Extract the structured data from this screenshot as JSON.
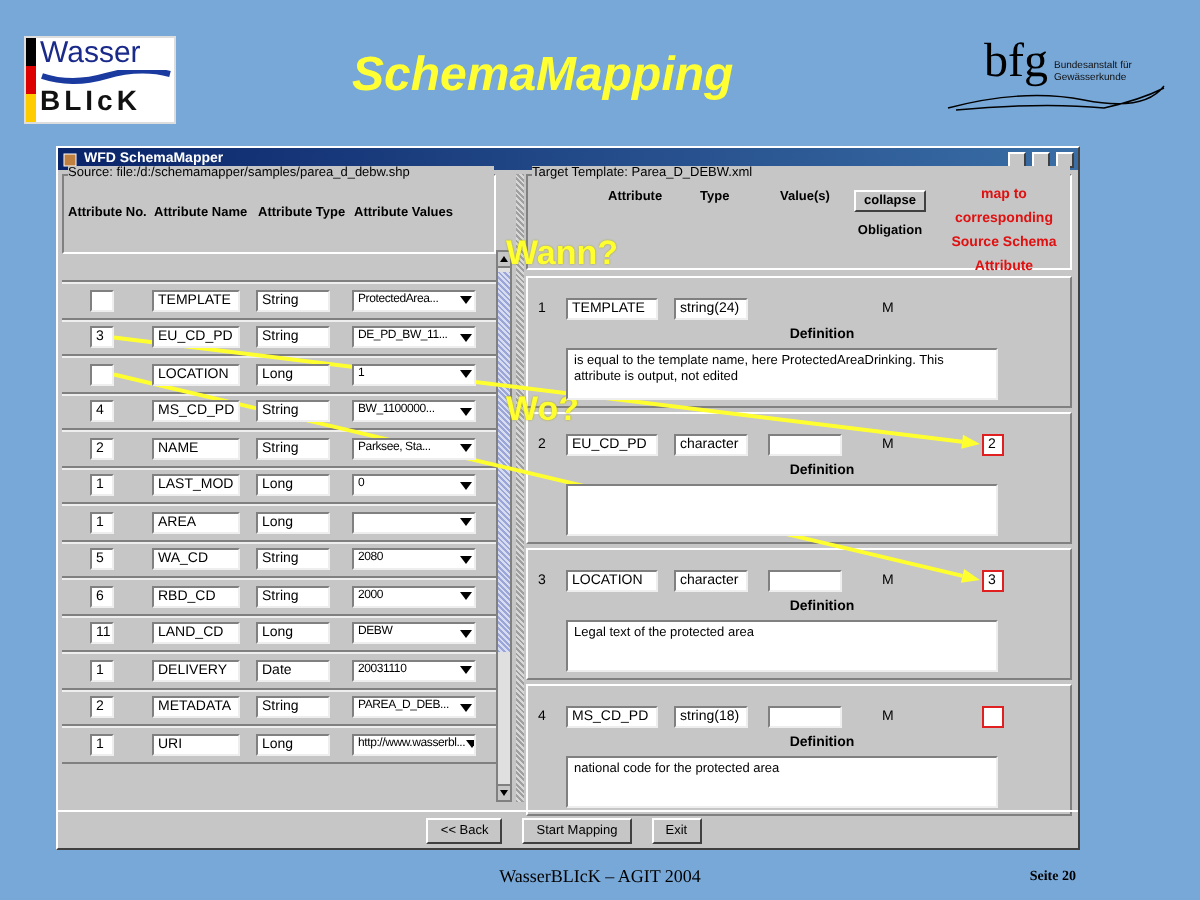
{
  "header": {
    "logo_top": "Wasser",
    "logo_bottom": "BLIcK",
    "title": "SchemaMapping",
    "partner_logo": "bfg",
    "partner_subtitle": "Bundesanstalt für Gewässerkunde"
  },
  "window": {
    "title": "WFD SchemaMapper"
  },
  "source": {
    "legend": "Source: file:/d:/schemamapper/samples/parea_d_debw.shp",
    "columns": [
      "Attribute No.",
      "Attribute Name",
      "Attribute Type",
      "Attribute Values"
    ],
    "rows": [
      {
        "name": "TEMPLATE",
        "type": "String",
        "value": "ProtectedArea..."
      },
      {
        "number": "3",
        "name": "EU_CD_PD",
        "type": "String",
        "value": "DE_PD_BW_11..."
      },
      {
        "name": "LOCATION",
        "type": "Long",
        "value": "1"
      },
      {
        "number": "4",
        "name": "MS_CD_PD",
        "type": "String",
        "value": "BW_1100000..."
      },
      {
        "number": "2",
        "name": "NAME",
        "type": "String",
        "value": "Parksee, Sta..."
      },
      {
        "number": "1",
        "name": "LAST_MOD",
        "type": "Long",
        "value": "0"
      },
      {
        "number": "1",
        "name": "AREA",
        "type": "Long"
      },
      {
        "number": "5",
        "name": "WA_CD",
        "type": "String",
        "value": "2080"
      },
      {
        "number": "6",
        "name": "RBD_CD",
        "type": "String",
        "value": "2000"
      },
      {
        "number": "11",
        "name": "LAND_CD",
        "type": "Long",
        "value": "DEBW"
      },
      {
        "number": "1",
        "name": "DELIVERY",
        "type": "Date",
        "value": "20031110"
      },
      {
        "number": "2",
        "name": "METADATA",
        "type": "String",
        "value": "PAREA_D_DEB..."
      },
      {
        "number": "1",
        "name": "URI",
        "type": "Long",
        "value": "http://www.wasserbl..."
      }
    ]
  },
  "target": {
    "legend": "Target Template: Parea_D_DEBW.xml",
    "columns": [
      "Attribute",
      "Type",
      "Value(s)"
    ],
    "collapse_button": "collapse",
    "obligation_heading": "Obligation",
    "map_hint": "map to corresponding Source Schema Attribute",
    "cards": [
      {
        "number": "1",
        "attribute": "TEMPLATE",
        "type": "string(24)",
        "value_field": false,
        "obligation": "M",
        "map_field": false,
        "definition_label": "Definition",
        "definition": "is equal to the template name, here ProtectedAreaDrinking. This attribute is output, not edited"
      },
      {
        "number": "2",
        "attribute": "EU_CD_PD",
        "type": "character",
        "value_field": true,
        "obligation": "M",
        "map_field": true,
        "map": "2",
        "definition_label": "Definition"
      },
      {
        "number": "3",
        "attribute": "LOCATION",
        "type": "character",
        "value_field": true,
        "obligation": "M",
        "map_field": true,
        "map": "3",
        "definition_label": "Definition",
        "definition": "Legal text of the protected area"
      },
      {
        "number": "4",
        "attribute": "MS_CD_PD",
        "type": "string(18)",
        "value_field": true,
        "obligation": "M",
        "map_field": true,
        "definition_label": "Definition",
        "definition": "national code for the protected area"
      }
    ]
  },
  "buttons": [
    "<< Back",
    "Start Mapping",
    "Exit"
  ],
  "annotations": [
    {
      "text": "Wann?"
    },
    {
      "text": "Wo?"
    }
  ],
  "footer": {
    "text": "WasserBLIcK – AGIT 2004",
    "page": "Seite 20"
  }
}
